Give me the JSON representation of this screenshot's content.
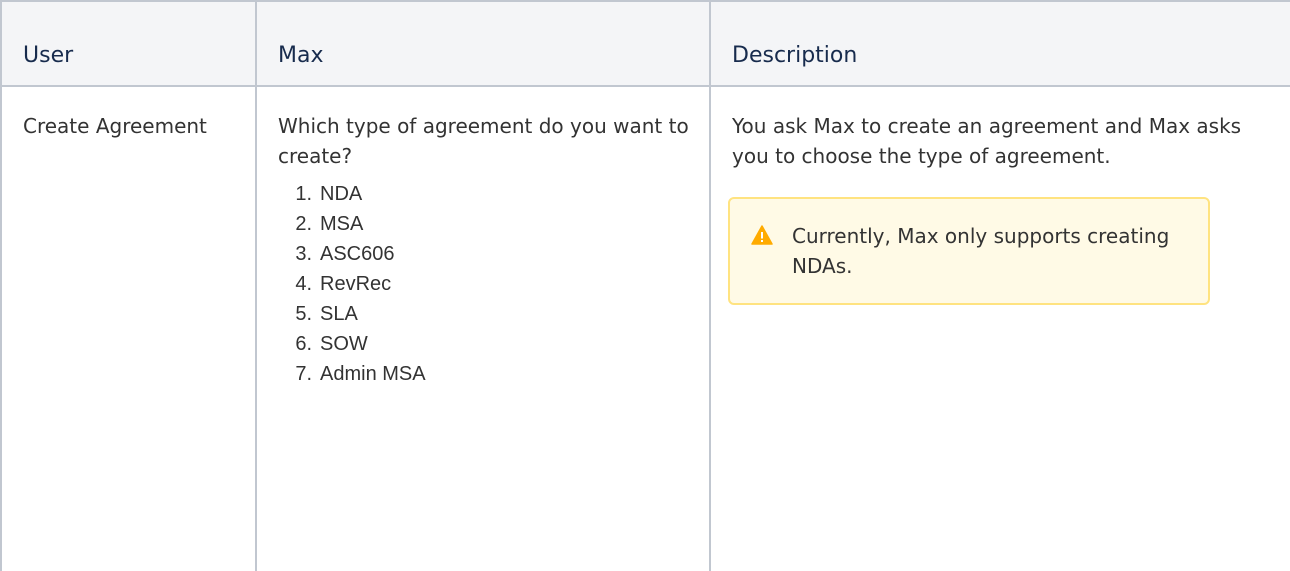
{
  "table": {
    "headers": {
      "user": "User",
      "max": "Max",
      "description": "Description"
    },
    "row": {
      "user": "Create Agreement",
      "max_prompt": "Which type of agreement do you want to create?",
      "options": [
        "NDA",
        "MSA",
        "ASC606",
        "RevRec",
        "SLA",
        "SOW",
        "Admin MSA"
      ],
      "description": "You ask Max to create an agreement and Max asks you to choose the type of agreement.",
      "note": {
        "icon": "warning-icon",
        "color": "#ffab00",
        "text": "Currently, Max only supports creating NDAs."
      }
    }
  }
}
